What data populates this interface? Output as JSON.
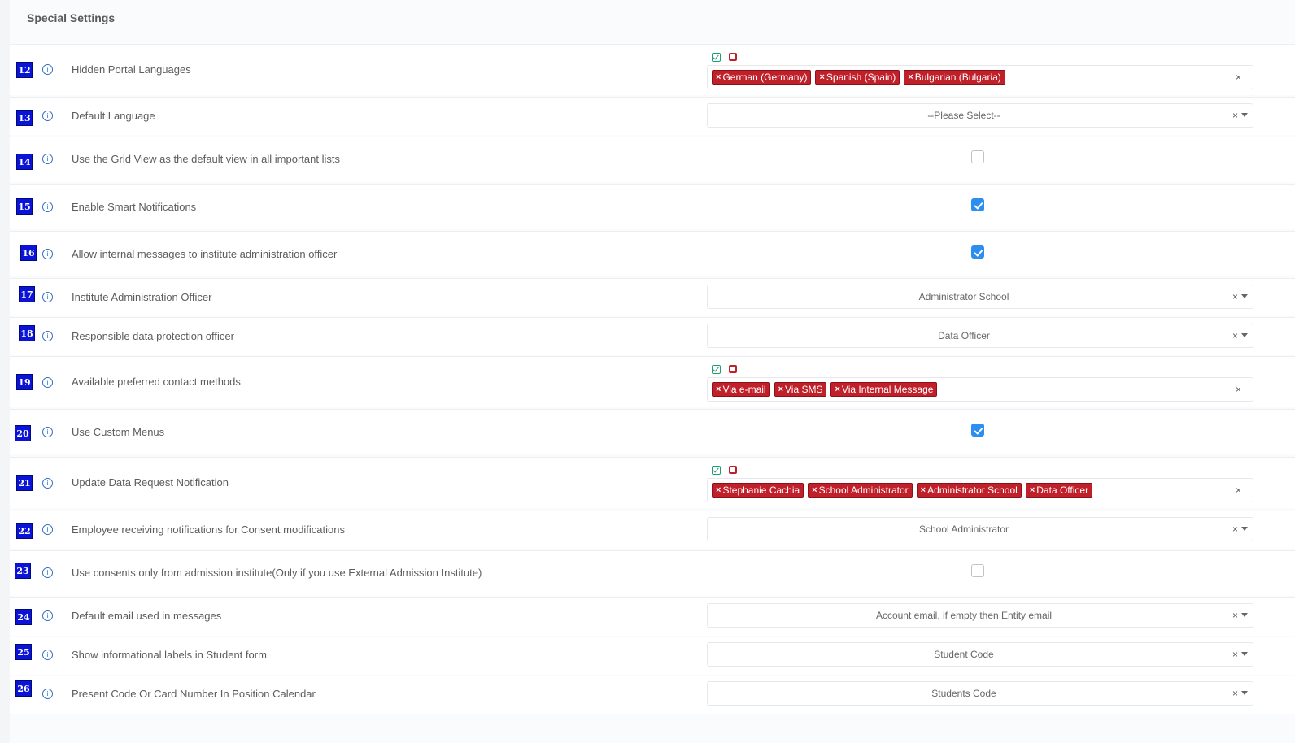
{
  "panel": {
    "title": "Special Settings"
  },
  "rows": {
    "r12": {
      "num": "12",
      "label": "Hidden Portal Languages",
      "tags": [
        "German (Germany)",
        "Spanish (Spain)",
        "Bulgarian (Bulgaria)"
      ],
      "clear": "×"
    },
    "r13": {
      "num": "13",
      "label": "Default Language",
      "value": "--Please Select--",
      "clear": "×"
    },
    "r14": {
      "num": "14",
      "label": "Use the Grid View as the default view in all important lists",
      "checked": false
    },
    "r15": {
      "num": "15",
      "label": "Enable Smart Notifications",
      "checked": true
    },
    "r16": {
      "num": "16",
      "label": "Allow internal messages to institute administration officer",
      "checked": true
    },
    "r17": {
      "num": "17",
      "label": "Institute Administration Officer",
      "value": "Administrator School",
      "clear": "×"
    },
    "r18": {
      "num": "18",
      "label": "Responsible data protection officer",
      "value": "Data Officer",
      "clear": "×"
    },
    "r19": {
      "num": "19",
      "label": "Available preferred contact methods",
      "tags": [
        "Via e-mail",
        "Via SMS",
        "Via Internal Message"
      ],
      "clear": "×"
    },
    "r20": {
      "num": "20",
      "label": "Use Custom Menus",
      "checked": true
    },
    "r21": {
      "num": "21",
      "label": "Update Data Request Notification",
      "tags": [
        "Stephanie Cachia",
        "School Administrator",
        "Administrator School",
        "Data Officer"
      ],
      "clear": "×"
    },
    "r22": {
      "num": "22",
      "label": "Employee receiving notifications for Consent modifications",
      "value": "School Administrator",
      "clear": "×"
    },
    "r23": {
      "num": "23",
      "label": "Use consents only from admission institute(Only if you use External Admission Institute)",
      "checked": false
    },
    "r24": {
      "num": "24",
      "label": "Default email used in messages",
      "value": "Account email, if empty then Entity email",
      "clear": "×"
    },
    "r25": {
      "num": "25",
      "label": "Show informational labels in Student form",
      "value": "Student Code",
      "clear": "×"
    },
    "r26": {
      "num": "26",
      "label": "Present Code Or Card Number In Position Calendar",
      "value": "Students Code",
      "clear": "×"
    }
  },
  "icons": {
    "info": "info-circle-icon",
    "select_all": "check-square-icon",
    "deselect_all": "square-icon",
    "tag_remove": "×"
  },
  "colors": {
    "badge": "#0b14d6",
    "tag": "#c0202a",
    "checkbox_on": "#2c8ff0",
    "select_all": "#1f9e6e",
    "deselect_all": "#c0202a"
  }
}
